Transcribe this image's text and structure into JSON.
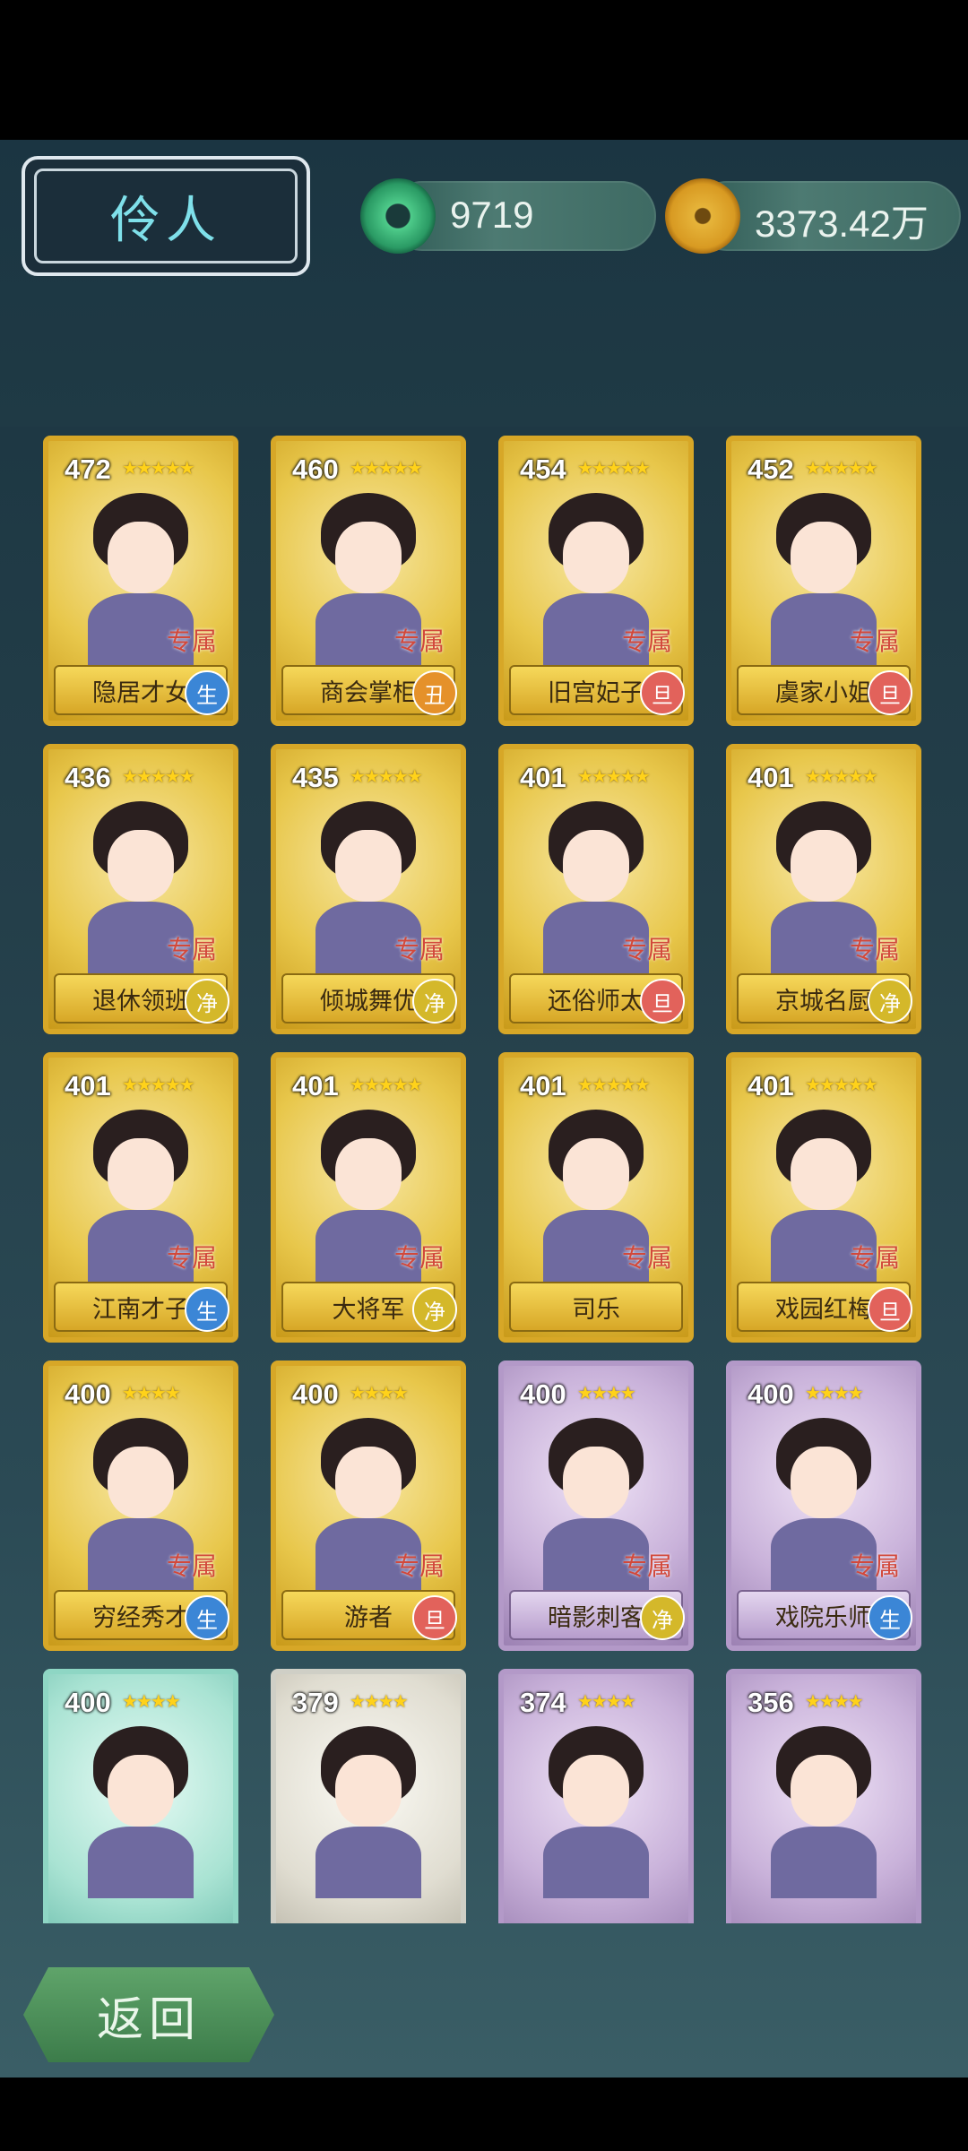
{
  "header": {
    "title": "伶人",
    "jade_value": "9719",
    "coin_value": "3373.42万",
    "jade_icon": "jade-ring-icon",
    "coin_icon": "copper-coin-icon"
  },
  "cards": [
    {
      "rank": "472",
      "stars": "★★★★★",
      "name": "隐居才女",
      "tag": "专属",
      "badge": "生",
      "badge_color": "#3b86d6",
      "style": "gold"
    },
    {
      "rank": "460",
      "stars": "★★★★★",
      "name": "商会掌柜",
      "tag": "专属",
      "badge": "丑",
      "badge_color": "#e5912a",
      "style": "gold"
    },
    {
      "rank": "454",
      "stars": "★★★★★",
      "name": "旧宫妃子",
      "tag": "专属",
      "badge": "旦",
      "badge_color": "#e2625b",
      "style": "gold"
    },
    {
      "rank": "452",
      "stars": "★★★★★",
      "name": "虞家小姐",
      "tag": "专属",
      "badge": "旦",
      "badge_color": "#e2625b",
      "style": "gold"
    },
    {
      "rank": "436",
      "stars": "★★★★★",
      "name": "退休领班",
      "tag": "专属",
      "badge": "净",
      "badge_color": "#d4b82a",
      "style": "gold"
    },
    {
      "rank": "435",
      "stars": "★★★★★",
      "name": "倾城舞优",
      "tag": "专属",
      "badge": "净",
      "badge_color": "#d4b82a",
      "style": "gold"
    },
    {
      "rank": "401",
      "stars": "★★★★★",
      "name": "还俗师太",
      "tag": "专属",
      "badge": "旦",
      "badge_color": "#e2625b",
      "style": "gold"
    },
    {
      "rank": "401",
      "stars": "★★★★★",
      "name": "京城名厨",
      "tag": "专属",
      "badge": "净",
      "badge_color": "#d4b82a",
      "style": "gold"
    },
    {
      "rank": "401",
      "stars": "★★★★★",
      "name": "江南才子",
      "tag": "专属",
      "badge": "生",
      "badge_color": "#3b86d6",
      "style": "gold"
    },
    {
      "rank": "401",
      "stars": "★★★★★",
      "name": "大将军",
      "tag": "专属",
      "badge": "净",
      "badge_color": "#d4b82a",
      "style": "gold"
    },
    {
      "rank": "401",
      "stars": "★★★★★",
      "name": "司乐",
      "tag": "专属",
      "badge": "",
      "badge_color": "",
      "style": "gold"
    },
    {
      "rank": "401",
      "stars": "★★★★★",
      "name": "戏园红梅",
      "tag": "专属",
      "badge": "旦",
      "badge_color": "#e2625b",
      "style": "gold"
    },
    {
      "rank": "400",
      "stars": "★★★★",
      "name": "穷经秀才",
      "tag": "专属",
      "badge": "生",
      "badge_color": "#3b86d6",
      "style": "gold"
    },
    {
      "rank": "400",
      "stars": "★★★★",
      "name": "游者",
      "tag": "专属",
      "badge": "旦",
      "badge_color": "#e2625b",
      "style": "gold"
    },
    {
      "rank": "400",
      "stars": "★★★★",
      "name": "暗影刺客",
      "tag": "专属",
      "badge": "净",
      "badge_color": "#d4b82a",
      "style": "purple"
    },
    {
      "rank": "400",
      "stars": "★★★★",
      "name": "戏院乐师",
      "tag": "专属",
      "badge": "生",
      "badge_color": "#3b86d6",
      "style": "purple"
    },
    {
      "rank": "400",
      "stars": "★★★★",
      "name": "",
      "tag": "",
      "badge": "",
      "badge_color": "",
      "style": "teal"
    },
    {
      "rank": "379",
      "stars": "★★★★",
      "name": "",
      "tag": "",
      "badge": "",
      "badge_color": "",
      "style": "white"
    },
    {
      "rank": "374",
      "stars": "★★★★",
      "name": "",
      "tag": "",
      "badge": "",
      "badge_color": "",
      "style": "purple"
    },
    {
      "rank": "356",
      "stars": "★★★★",
      "name": "",
      "tag": "",
      "badge": "",
      "badge_color": "",
      "style": "purple"
    }
  ],
  "footer": {
    "back_label": "返回"
  }
}
